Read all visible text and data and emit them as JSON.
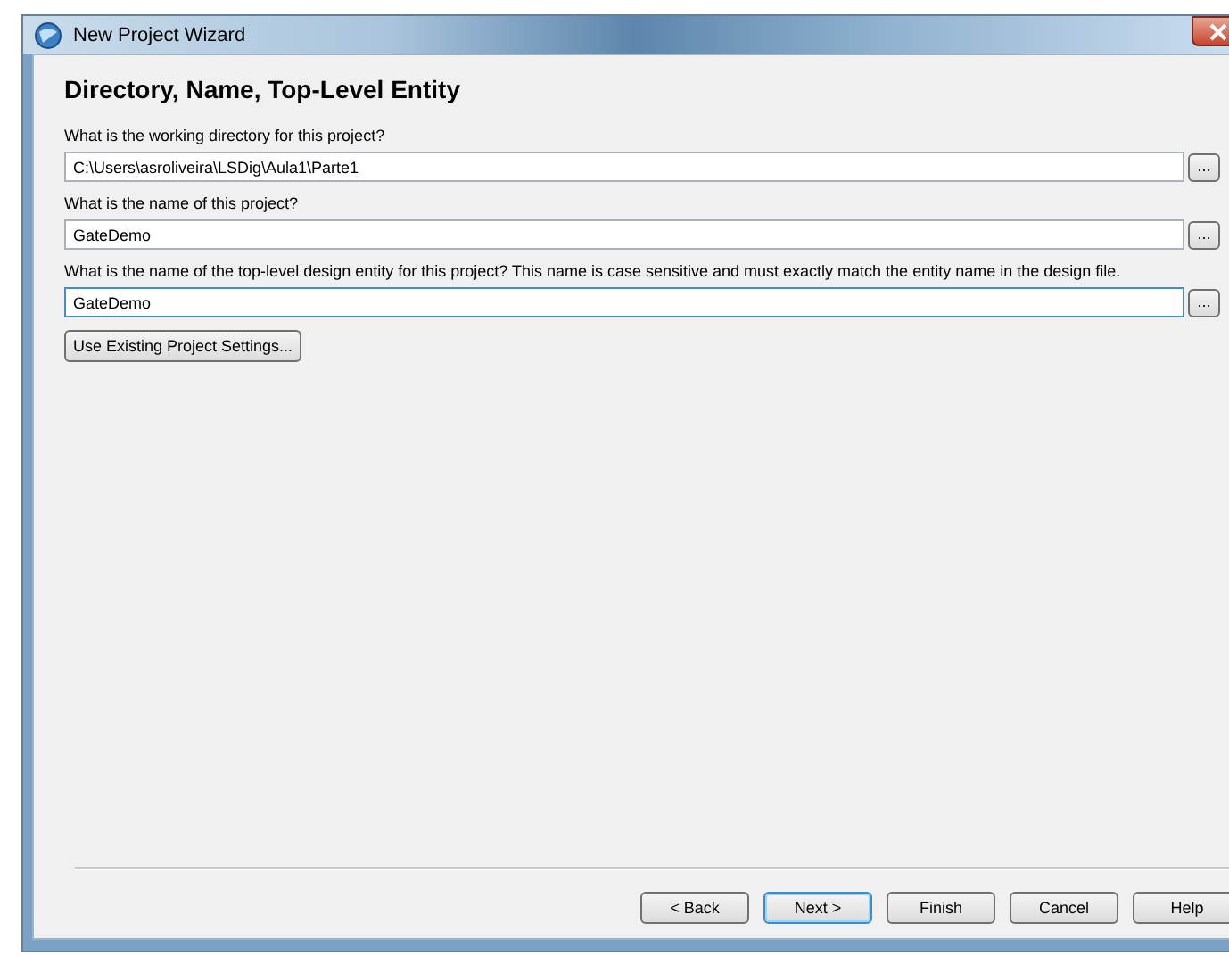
{
  "window": {
    "title": "New Project Wizard"
  },
  "heading": "Directory, Name, Top-Level Entity",
  "fields": [
    {
      "label": "What is the working directory for this project?",
      "value": "C:\\Users\\asroliveira\\LSDig\\Aula1\\Parte1",
      "focused": false,
      "browse": "..."
    },
    {
      "label": "What is the name of this project?",
      "value": "GateDemo",
      "focused": false,
      "browse": "..."
    },
    {
      "label": "What is the name of the top-level design entity for this project? This name is case sensitive and must exactly match the entity name in the design file.",
      "value": "GateDemo",
      "focused": true,
      "browse": "..."
    }
  ],
  "settings_button": "Use Existing Project Settings...",
  "buttons": [
    {
      "label": "< Back",
      "default": false
    },
    {
      "label": "Next >",
      "default": true
    },
    {
      "label": "Finish",
      "default": false
    },
    {
      "label": "Cancel",
      "default": false
    },
    {
      "label": "Help",
      "default": false
    }
  ]
}
